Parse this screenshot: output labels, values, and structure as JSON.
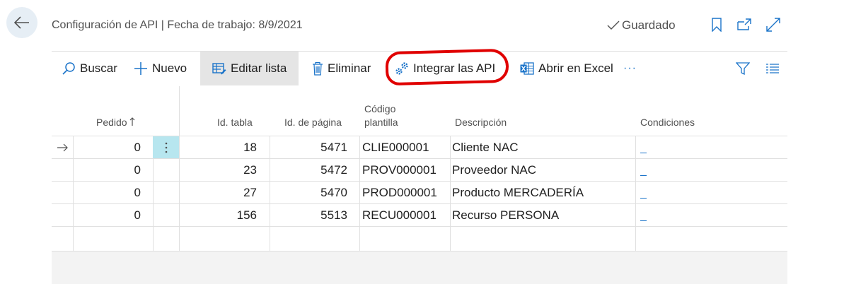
{
  "header": {
    "title": "Configuración de API | Fecha de trabajo: 8/9/2021",
    "saved_label": "Guardado"
  },
  "actions": {
    "search": "Buscar",
    "new": "Nuevo",
    "edit_list": "Editar lista",
    "delete": "Eliminar",
    "integrate": "Integrar las API",
    "open_excel": "Abrir en Excel",
    "more": "···"
  },
  "columns": {
    "order": "Pedido",
    "table_id": "Id. tabla",
    "page_id": "Id. de página",
    "template_line1": "Código",
    "template_line2": "plantilla",
    "description": "Descripción",
    "conditions": "Condiciones"
  },
  "rows": [
    {
      "order": "0",
      "table_id": "18",
      "page_id": "5471",
      "template": "CLIE000001",
      "description": "Cliente NAC"
    },
    {
      "order": "0",
      "table_id": "23",
      "page_id": "5472",
      "template": "PROV000001",
      "description": "Proveedor NAC"
    },
    {
      "order": "0",
      "table_id": "27",
      "page_id": "5470",
      "template": "PROD000001",
      "description": "Producto MERCADERÍA"
    },
    {
      "order": "0",
      "table_id": "156",
      "page_id": "5513",
      "template": "RECU000001",
      "description": "Recurso PERSONA"
    }
  ],
  "colors": {
    "accent": "#1a73c9",
    "highlight_circle": "#e00000",
    "row_selector": "#b7e6ef"
  }
}
